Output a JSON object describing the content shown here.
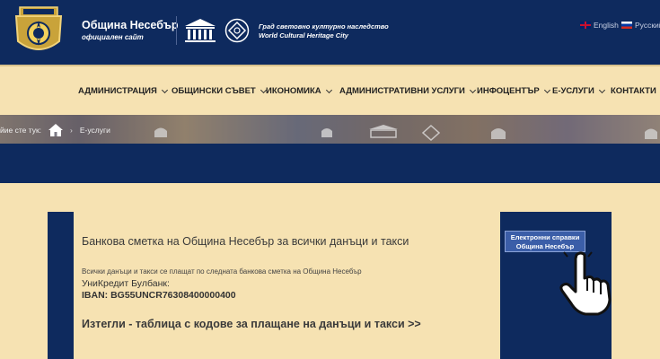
{
  "header": {
    "site_name": "Община Несебър",
    "site_subtitle": "официален сайт",
    "heritage_line1": "Град световно културно наследство",
    "heritage_line2": "World Cultural Heritage City",
    "lang_en": "English",
    "lang_ru": "Русский"
  },
  "nav": {
    "items": [
      "АДМИНИСТРАЦИЯ",
      "ОБЩИНСКИ СЪВЕТ",
      "ИКОНОМИКА",
      "АДМИНИСТРАТИВНИ УСЛУГИ",
      "ИНФОЦЕНТЪР",
      "Е-УСЛУГИ",
      "КОНТАКТИ"
    ]
  },
  "breadcrumb": {
    "prefix": "йие сте тук:",
    "current": "Е-услуги"
  },
  "content": {
    "title": "Банкова сметка на Община Несебър за всички данъци и такси",
    "note": "Всички данъци и такси се плащат по следната банкова сметка на Община Несебър",
    "bank": "УниКредит Булбанк:",
    "iban": "IBAN: BG55UNCR76308400000400",
    "download_link": "Изтегли - таблица с кодове за плащане на данъци и такси >>"
  },
  "sidebar": {
    "eservices_line1": "Електронни справки",
    "eservices_line2": "Община Несебър"
  },
  "colors": {
    "navy": "#0e2a5e",
    "cream": "#f6e2b2"
  }
}
